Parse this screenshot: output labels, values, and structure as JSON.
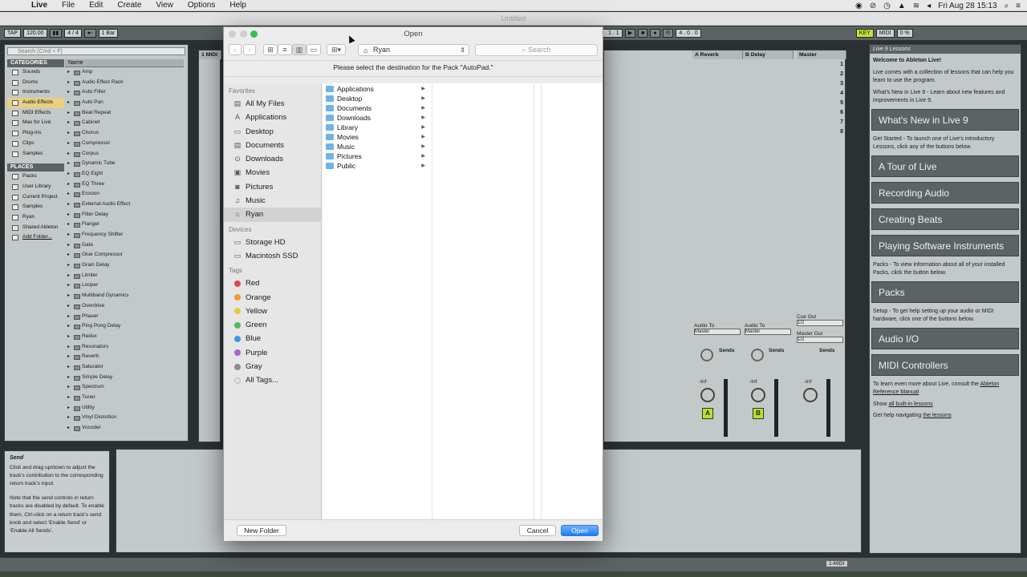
{
  "menubar": {
    "app": "Live",
    "items": [
      "File",
      "Edit",
      "Create",
      "View",
      "Options",
      "Help"
    ],
    "clock": "Fri Aug 28  15:13"
  },
  "window_title": "Untitled",
  "transport": {
    "tap": "TAP",
    "tempo": "120.00",
    "sig": "4 / 4",
    "quant": "1 Bar",
    "pos": "3 . 1 . 1",
    "loop": "4 . 0 . 0",
    "key": "KEY",
    "midi": "MIDI",
    "cpu": "0 %"
  },
  "browser": {
    "search_placeholder": "Search (Cmd + F)",
    "categories_header": "CATEGORIES",
    "categories": [
      "Sounds",
      "Drums",
      "Instruments",
      "Audio Effects",
      "MIDI Effects",
      "Max for Live",
      "Plug-ins",
      "Clips",
      "Samples"
    ],
    "places_header": "PLACES",
    "places": [
      "Packs",
      "User Library",
      "Current Project",
      "Samples",
      "Ryan",
      "Shared Ableton",
      "Add Folder..."
    ],
    "name_header": "Name",
    "names": [
      "Amp",
      "Audio Effect Rack",
      "Auto Filter",
      "Auto Pan",
      "Beat Repeat",
      "Cabinet",
      "Chorus",
      "Compressor",
      "Corpus",
      "Dynamic Tube",
      "EQ Eight",
      "EQ Three",
      "Erosion",
      "External Audio Effect",
      "Filter Delay",
      "Flanger",
      "Frequency Shifter",
      "Gate",
      "Glue Compressor",
      "Grain Delay",
      "Limiter",
      "Looper",
      "Multiband Dynamics",
      "Overdrive",
      "Phaser",
      "Ping Pong Delay",
      "Redux",
      "Resonators",
      "Reverb",
      "Saturator",
      "Simple Delay",
      "Spectrum",
      "Tuner",
      "Utility",
      "Vinyl Distortion",
      "Vocoder"
    ]
  },
  "info": {
    "title": "Send",
    "body1": "Click and drag up/down to adjust the track's contribution to the corresponding return track's input.",
    "body2": "Note that the send controls in return tracks are disabled by default. To enable them, Ctrl-click on a return track's send knob and select 'Enable Send' or 'Enable All Sends'."
  },
  "session": {
    "track1": "1 MIDI",
    "return_a": "A Reverb",
    "return_b": "B Delay",
    "master": "Master",
    "scenes": [
      "1",
      "2",
      "3",
      "4",
      "5",
      "6",
      "7",
      "8"
    ],
    "audio_to": "Audio To",
    "master_label": "Master",
    "cue_out": "Cue Out",
    "master_out": "Master Out",
    "out_val": "1/2",
    "sends": "Sends",
    "inf": "-Inf",
    "letters": [
      "A",
      "B"
    ]
  },
  "lessons": {
    "title": "Live 9 Lessons",
    "welcome": "Welcome to Ableton Live!",
    "p1": "Live comes with a collection of lessons that can help you learn to use the program.",
    "p2": "What's New in Live 9 - Learn about new features and improvements in Live 9.",
    "btn_new": "What's New in Live 9",
    "p3": "Get Started - To launch one of Live's introductory Lessons, click any of the buttons below.",
    "btn_tour": "A Tour of Live",
    "btn_rec": "Recording Audio",
    "btn_beats": "Creating Beats",
    "btn_soft": "Playing Software Instruments",
    "p4": "Packs - To view information about all of your installed Packs, click the button below.",
    "btn_packs": "Packs",
    "p5": "Setup - To get help setting up your audio or MIDI hardware, click one of the buttons below.",
    "btn_audio": "Audio I/O",
    "btn_midi": "MIDI Controllers",
    "p6": "To learn even more about Live, consult the",
    "link_manual": "Ableton Reference Manual",
    "p7": "Show",
    "link_all": "all built-in lessons",
    "p8": "Get help navigating",
    "link_nav": "the lessons"
  },
  "dialog": {
    "title": "Open",
    "location": "Ryan",
    "search_placeholder": "Search",
    "message": "Please select the destination for the Pack \"AutoPad.\"",
    "favorites_header": "Favorites",
    "favorites": [
      {
        "label": "All My Files",
        "icon": "all-files"
      },
      {
        "label": "Applications",
        "icon": "applications"
      },
      {
        "label": "Desktop",
        "icon": "desktop"
      },
      {
        "label": "Documents",
        "icon": "documents"
      },
      {
        "label": "Downloads",
        "icon": "downloads"
      },
      {
        "label": "Movies",
        "icon": "movies"
      },
      {
        "label": "Pictures",
        "icon": "pictures"
      },
      {
        "label": "Music",
        "icon": "music"
      },
      {
        "label": "Ryan",
        "icon": "home"
      }
    ],
    "devices_header": "Devices",
    "devices": [
      "Storage HD",
      "Macintosh SSD"
    ],
    "tags_header": "Tags",
    "tags": [
      {
        "label": "Red",
        "color": "#e0474c"
      },
      {
        "label": "Orange",
        "color": "#f19b31"
      },
      {
        "label": "Yellow",
        "color": "#e8c940"
      },
      {
        "label": "Green",
        "color": "#4cbe56"
      },
      {
        "label": "Blue",
        "color": "#3a9ae4"
      },
      {
        "label": "Purple",
        "color": "#b05fd1"
      },
      {
        "label": "Gray",
        "color": "#8e8e8e"
      },
      {
        "label": "All Tags...",
        "color": "#e2e2e2"
      }
    ],
    "folders": [
      "Applications",
      "Desktop",
      "Documents",
      "Downloads",
      "Library",
      "Movies",
      "Music",
      "Pictures",
      "Public"
    ],
    "new_folder": "New Folder",
    "cancel": "Cancel",
    "open": "Open"
  },
  "status": {
    "track": "1-MIDI"
  }
}
